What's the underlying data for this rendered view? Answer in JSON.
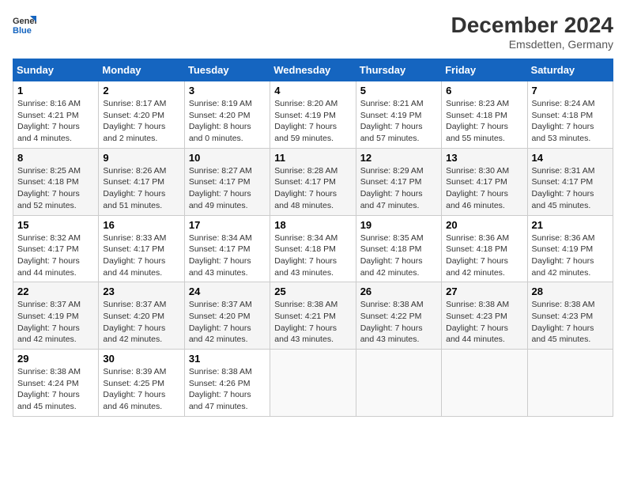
{
  "logo": {
    "line1": "General",
    "line2": "Blue"
  },
  "title": "December 2024",
  "location": "Emsdetten, Germany",
  "days_of_week": [
    "Sunday",
    "Monday",
    "Tuesday",
    "Wednesday",
    "Thursday",
    "Friday",
    "Saturday"
  ],
  "weeks": [
    [
      {
        "num": "1",
        "sunrise": "Sunrise: 8:16 AM",
        "sunset": "Sunset: 4:21 PM",
        "daylight": "Daylight: 7 hours and 4 minutes."
      },
      {
        "num": "2",
        "sunrise": "Sunrise: 8:17 AM",
        "sunset": "Sunset: 4:20 PM",
        "daylight": "Daylight: 7 hours and 2 minutes."
      },
      {
        "num": "3",
        "sunrise": "Sunrise: 8:19 AM",
        "sunset": "Sunset: 4:20 PM",
        "daylight": "Daylight: 8 hours and 0 minutes."
      },
      {
        "num": "4",
        "sunrise": "Sunrise: 8:20 AM",
        "sunset": "Sunset: 4:19 PM",
        "daylight": "Daylight: 7 hours and 59 minutes."
      },
      {
        "num": "5",
        "sunrise": "Sunrise: 8:21 AM",
        "sunset": "Sunset: 4:19 PM",
        "daylight": "Daylight: 7 hours and 57 minutes."
      },
      {
        "num": "6",
        "sunrise": "Sunrise: 8:23 AM",
        "sunset": "Sunset: 4:18 PM",
        "daylight": "Daylight: 7 hours and 55 minutes."
      },
      {
        "num": "7",
        "sunrise": "Sunrise: 8:24 AM",
        "sunset": "Sunset: 4:18 PM",
        "daylight": "Daylight: 7 hours and 53 minutes."
      }
    ],
    [
      {
        "num": "8",
        "sunrise": "Sunrise: 8:25 AM",
        "sunset": "Sunset: 4:18 PM",
        "daylight": "Daylight: 7 hours and 52 minutes."
      },
      {
        "num": "9",
        "sunrise": "Sunrise: 8:26 AM",
        "sunset": "Sunset: 4:17 PM",
        "daylight": "Daylight: 7 hours and 51 minutes."
      },
      {
        "num": "10",
        "sunrise": "Sunrise: 8:27 AM",
        "sunset": "Sunset: 4:17 PM",
        "daylight": "Daylight: 7 hours and 49 minutes."
      },
      {
        "num": "11",
        "sunrise": "Sunrise: 8:28 AM",
        "sunset": "Sunset: 4:17 PM",
        "daylight": "Daylight: 7 hours and 48 minutes."
      },
      {
        "num": "12",
        "sunrise": "Sunrise: 8:29 AM",
        "sunset": "Sunset: 4:17 PM",
        "daylight": "Daylight: 7 hours and 47 minutes."
      },
      {
        "num": "13",
        "sunrise": "Sunrise: 8:30 AM",
        "sunset": "Sunset: 4:17 PM",
        "daylight": "Daylight: 7 hours and 46 minutes."
      },
      {
        "num": "14",
        "sunrise": "Sunrise: 8:31 AM",
        "sunset": "Sunset: 4:17 PM",
        "daylight": "Daylight: 7 hours and 45 minutes."
      }
    ],
    [
      {
        "num": "15",
        "sunrise": "Sunrise: 8:32 AM",
        "sunset": "Sunset: 4:17 PM",
        "daylight": "Daylight: 7 hours and 44 minutes."
      },
      {
        "num": "16",
        "sunrise": "Sunrise: 8:33 AM",
        "sunset": "Sunset: 4:17 PM",
        "daylight": "Daylight: 7 hours and 44 minutes."
      },
      {
        "num": "17",
        "sunrise": "Sunrise: 8:34 AM",
        "sunset": "Sunset: 4:17 PM",
        "daylight": "Daylight: 7 hours and 43 minutes."
      },
      {
        "num": "18",
        "sunrise": "Sunrise: 8:34 AM",
        "sunset": "Sunset: 4:18 PM",
        "daylight": "Daylight: 7 hours and 43 minutes."
      },
      {
        "num": "19",
        "sunrise": "Sunrise: 8:35 AM",
        "sunset": "Sunset: 4:18 PM",
        "daylight": "Daylight: 7 hours and 42 minutes."
      },
      {
        "num": "20",
        "sunrise": "Sunrise: 8:36 AM",
        "sunset": "Sunset: 4:18 PM",
        "daylight": "Daylight: 7 hours and 42 minutes."
      },
      {
        "num": "21",
        "sunrise": "Sunrise: 8:36 AM",
        "sunset": "Sunset: 4:19 PM",
        "daylight": "Daylight: 7 hours and 42 minutes."
      }
    ],
    [
      {
        "num": "22",
        "sunrise": "Sunrise: 8:37 AM",
        "sunset": "Sunset: 4:19 PM",
        "daylight": "Daylight: 7 hours and 42 minutes."
      },
      {
        "num": "23",
        "sunrise": "Sunrise: 8:37 AM",
        "sunset": "Sunset: 4:20 PM",
        "daylight": "Daylight: 7 hours and 42 minutes."
      },
      {
        "num": "24",
        "sunrise": "Sunrise: 8:37 AM",
        "sunset": "Sunset: 4:20 PM",
        "daylight": "Daylight: 7 hours and 42 minutes."
      },
      {
        "num": "25",
        "sunrise": "Sunrise: 8:38 AM",
        "sunset": "Sunset: 4:21 PM",
        "daylight": "Daylight: 7 hours and 43 minutes."
      },
      {
        "num": "26",
        "sunrise": "Sunrise: 8:38 AM",
        "sunset": "Sunset: 4:22 PM",
        "daylight": "Daylight: 7 hours and 43 minutes."
      },
      {
        "num": "27",
        "sunrise": "Sunrise: 8:38 AM",
        "sunset": "Sunset: 4:23 PM",
        "daylight": "Daylight: 7 hours and 44 minutes."
      },
      {
        "num": "28",
        "sunrise": "Sunrise: 8:38 AM",
        "sunset": "Sunset: 4:23 PM",
        "daylight": "Daylight: 7 hours and 45 minutes."
      }
    ],
    [
      {
        "num": "29",
        "sunrise": "Sunrise: 8:38 AM",
        "sunset": "Sunset: 4:24 PM",
        "daylight": "Daylight: 7 hours and 45 minutes."
      },
      {
        "num": "30",
        "sunrise": "Sunrise: 8:39 AM",
        "sunset": "Sunset: 4:25 PM",
        "daylight": "Daylight: 7 hours and 46 minutes."
      },
      {
        "num": "31",
        "sunrise": "Sunrise: 8:38 AM",
        "sunset": "Sunset: 4:26 PM",
        "daylight": "Daylight: 7 hours and 47 minutes."
      },
      null,
      null,
      null,
      null
    ]
  ]
}
